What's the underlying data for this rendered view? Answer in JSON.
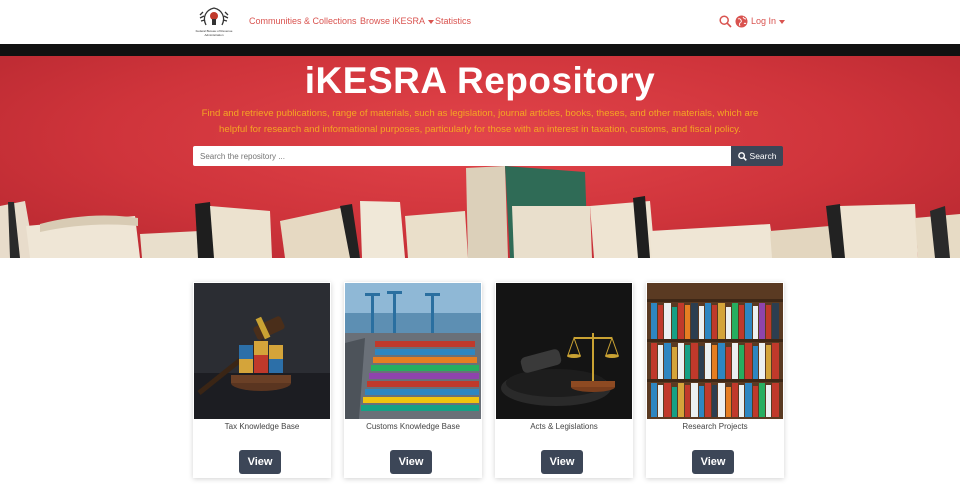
{
  "header": {
    "logo_caption_line1": "Federal Bureau of Revenue",
    "logo_caption_line2": "Administration",
    "nav": [
      {
        "label": "Communities & Collections"
      },
      {
        "label": "Browse iKESRA",
        "dropdown": true
      },
      {
        "label": "Statistics"
      }
    ],
    "search_icon": "search-icon",
    "language_icon": "globe-icon",
    "login_label": "Log In",
    "accent": "#d9534f"
  },
  "hero": {
    "title": "iKESRA Repository",
    "subtitle": "Find and retrieve publications, range of materials, such as legislation, journal articles, books, theses, and other materials, which are helpful for research and informational purposes, particularly for those with an interest in taxation, customs, and fiscal policy.",
    "search_placeholder": "Search the repository ...",
    "search_button": "Search",
    "background": "#d63a40",
    "subtitle_color": "#f5a623"
  },
  "cards": [
    {
      "title": "Tax Knowledge Base",
      "button": "View",
      "image": "gavel-tax-blocks"
    },
    {
      "title": "Customs Knowledge Base",
      "button": "View",
      "image": "container-port"
    },
    {
      "title": "Acts & Legislations",
      "button": "View",
      "image": "gavel-scales"
    },
    {
      "title": "Research Projects",
      "button": "View",
      "image": "bookshelf"
    }
  ]
}
